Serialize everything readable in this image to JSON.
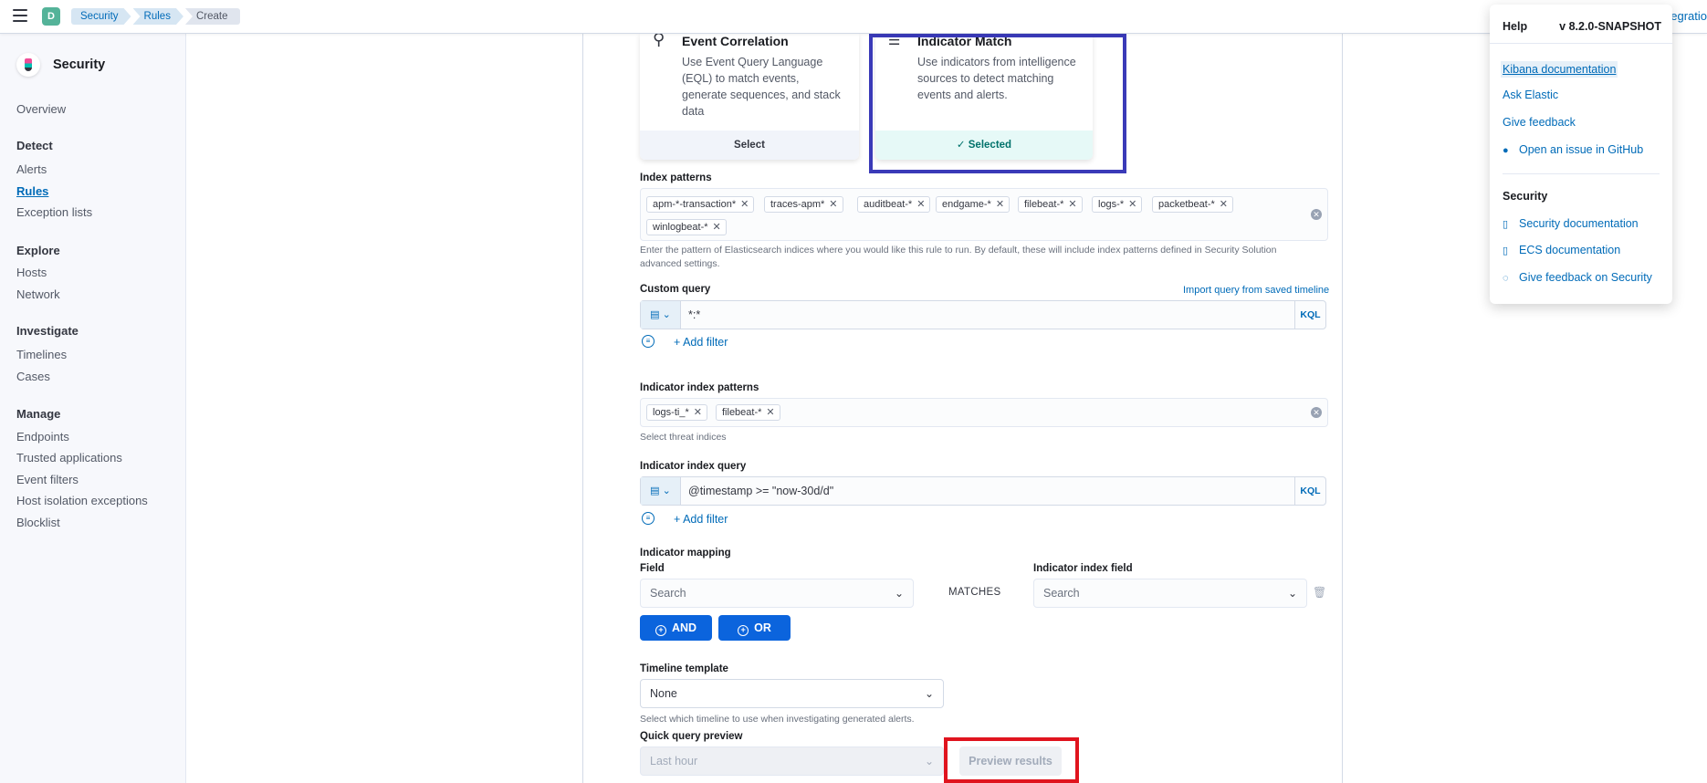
{
  "topbar": {
    "avatar_letter": "D",
    "breadcrumbs": [
      "Security",
      "Rules",
      "Create"
    ],
    "integrations_partial": "egratio"
  },
  "sidebar": {
    "title": "Security",
    "overview": "Overview",
    "sections": {
      "detect": "Detect",
      "explore": "Explore",
      "investigate": "Investigate",
      "manage": "Manage"
    },
    "items": {
      "alerts": "Alerts",
      "rules": "Rules",
      "exception_lists": "Exception lists",
      "hosts": "Hosts",
      "network": "Network",
      "timelines": "Timelines",
      "cases": "Cases",
      "endpoints": "Endpoints",
      "trusted_applications": "Trusted applications",
      "event_filters": "Event filters",
      "host_isolation_exceptions": "Host isolation exceptions",
      "blocklist": "Blocklist"
    }
  },
  "rule_types": {
    "eql": {
      "title": "Event Correlation",
      "description": "Use Event Query Language (EQL) to match events, generate sequences, and stack data",
      "action": "Select"
    },
    "indicator": {
      "title": "Indicator Match",
      "description": "Use indicators from intelligence sources to detect matching events and alerts.",
      "action": "Selected"
    }
  },
  "index_patterns": {
    "label": "Index patterns",
    "values": [
      "apm-*-transaction*",
      "traces-apm*",
      "auditbeat-*",
      "endgame-*",
      "filebeat-*",
      "logs-*",
      "packetbeat-*",
      "winlogbeat-*"
    ],
    "help": "Enter the pattern of Elasticsearch indices where you would like this rule to run. By default, these will include index patterns defined in Security Solution advanced settings."
  },
  "custom_query": {
    "label": "Custom query",
    "import_link": "Import query from saved timeline",
    "value": "*:*",
    "language": "KQL",
    "add_filter": "+ Add filter"
  },
  "indicator_index_patterns": {
    "label": "Indicator index patterns",
    "values": [
      "logs-ti_*",
      "filebeat-*"
    ],
    "help": "Select threat indices"
  },
  "indicator_index_query": {
    "label": "Indicator index query",
    "value": "@timestamp >= \"now-30d/d\"",
    "language": "KQL",
    "add_filter": "+ Add filter"
  },
  "indicator_mapping": {
    "label": "Indicator mapping",
    "field_label": "Field",
    "field_placeholder": "Search",
    "matches": "MATCHES",
    "index_field_label": "Indicator index field",
    "index_field_placeholder": "Search",
    "and_label": "AND",
    "or_label": "OR"
  },
  "timeline_template": {
    "label": "Timeline template",
    "value": "None",
    "help": "Select which timeline to use when investigating generated alerts."
  },
  "quick_query_preview": {
    "label": "Quick query preview",
    "range": "Last hour",
    "button": "Preview results"
  },
  "help_panel": {
    "title": "Help",
    "version": "v 8.2.0-SNAPSHOT",
    "links": [
      "Kibana documentation",
      "Ask Elastic",
      "Give feedback",
      "Open an issue in GitHub"
    ],
    "security_title": "Security",
    "security_links": [
      "Security documentation",
      "ECS documentation",
      "Give feedback on Security"
    ]
  },
  "colors": {
    "primary": "#006bb8",
    "button_fill": "#0b64dd",
    "highlight_blue": "#3a3ab8",
    "highlight_red": "#e0141e",
    "selected_green": "#00726b"
  }
}
